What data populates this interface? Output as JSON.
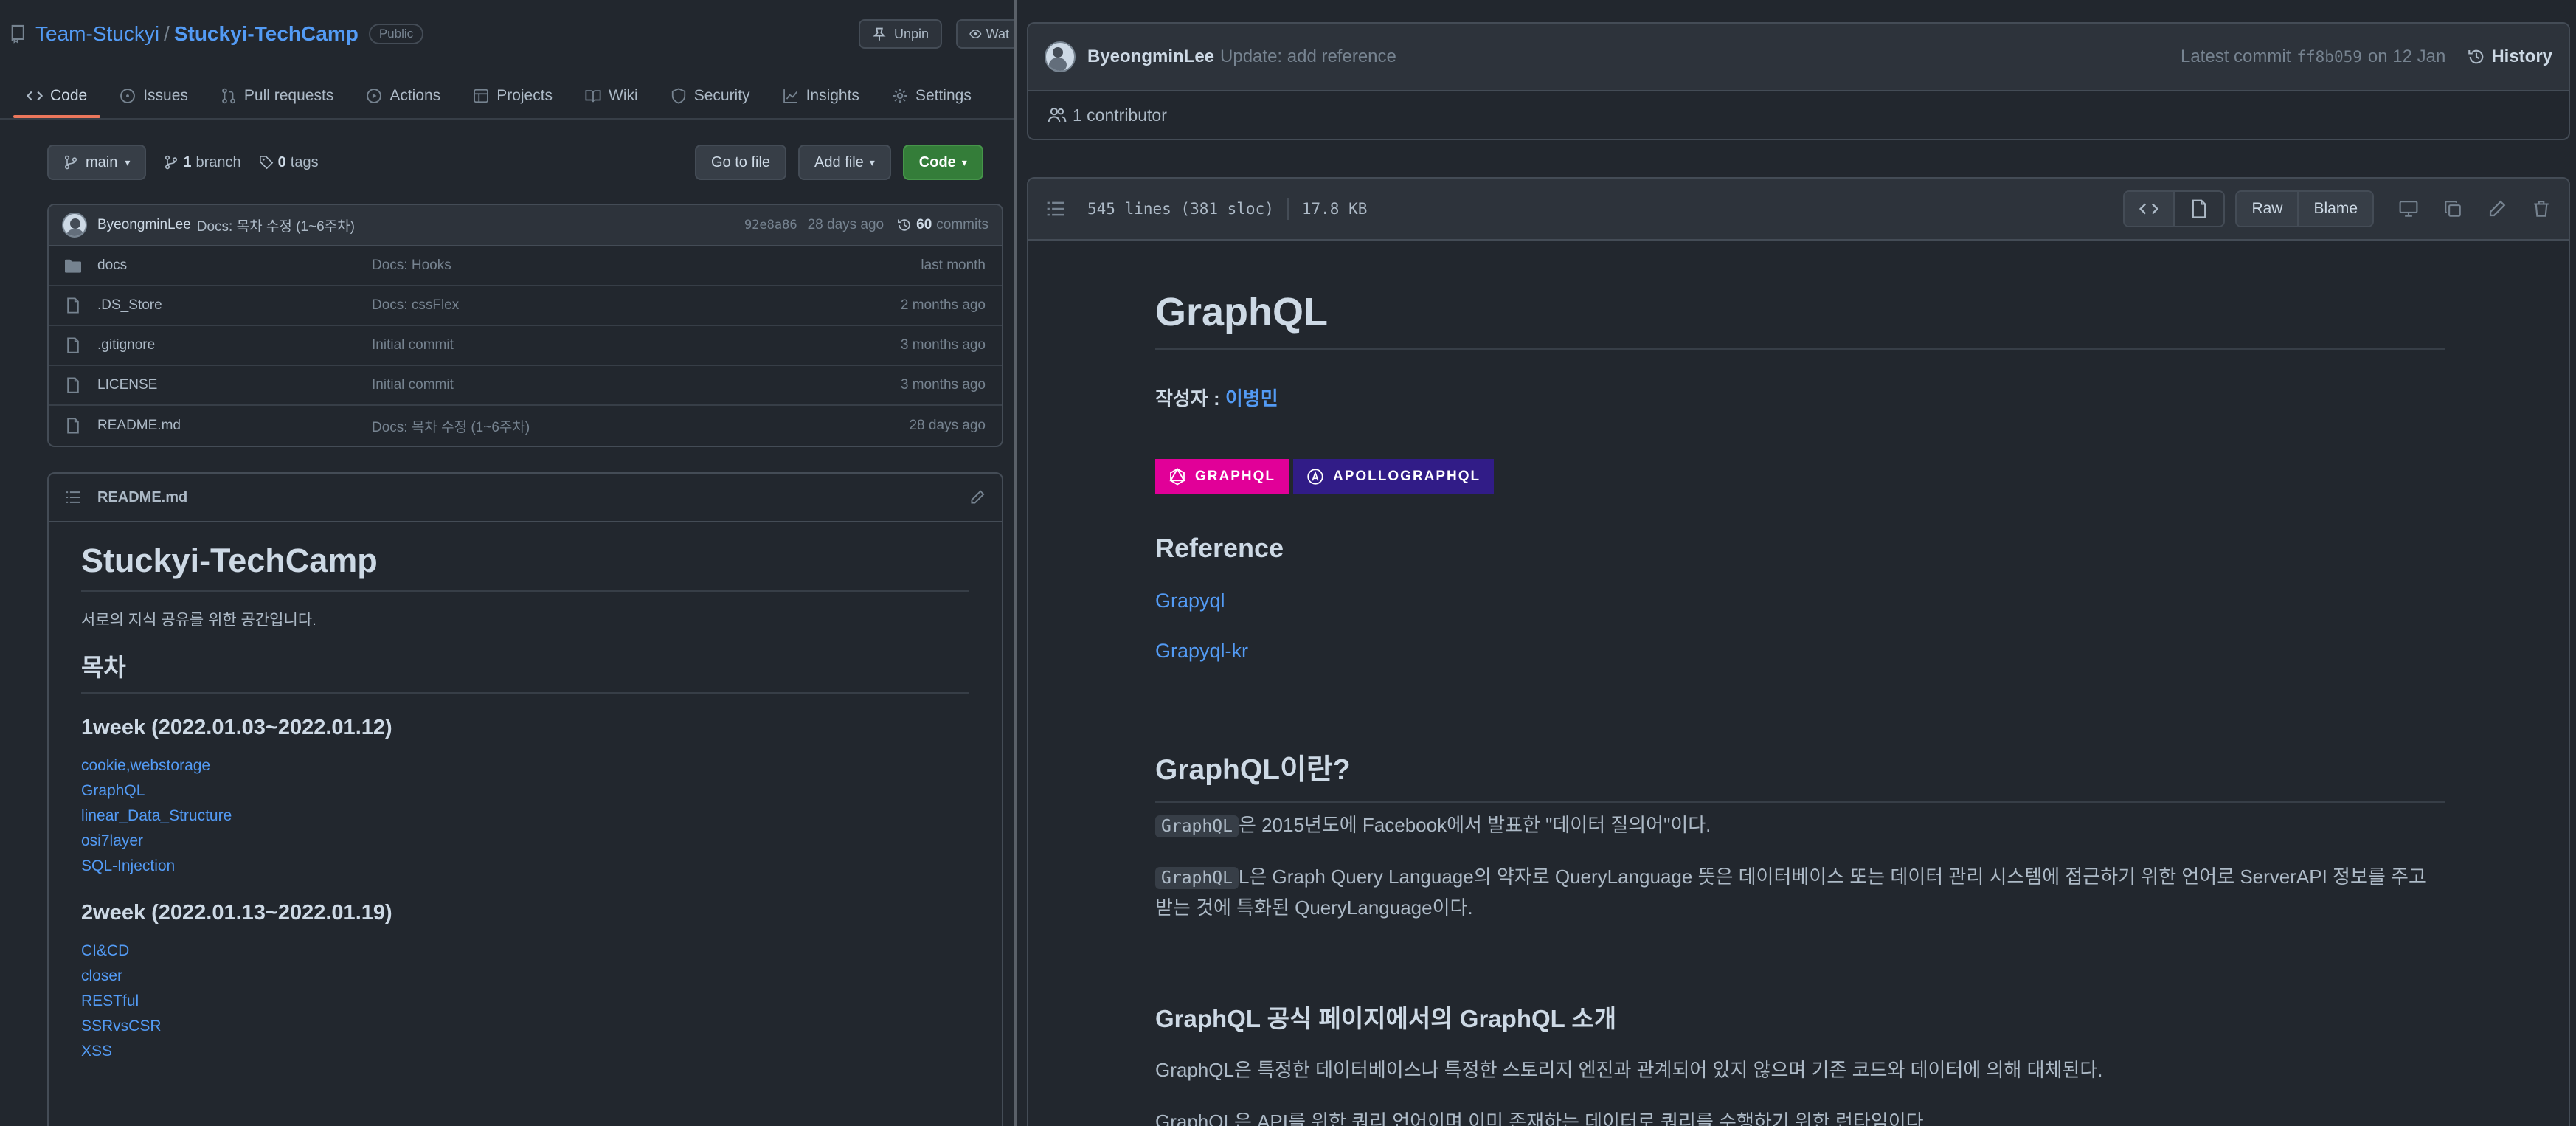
{
  "left": {
    "owner": "Team-Stuckyi",
    "separator": "/",
    "repo": "Stuckyi-TechCamp",
    "visibility": "Public",
    "unpin_label": "Unpin",
    "watch_label": "Wat",
    "tabs": [
      {
        "label": "Code",
        "icon": "code-icon"
      },
      {
        "label": "Issues",
        "icon": "issue-icon"
      },
      {
        "label": "Pull requests",
        "icon": "pull-request-icon"
      },
      {
        "label": "Actions",
        "icon": "play-icon"
      },
      {
        "label": "Projects",
        "icon": "table-icon"
      },
      {
        "label": "Wiki",
        "icon": "book-icon"
      },
      {
        "label": "Security",
        "icon": "shield-icon"
      },
      {
        "label": "Insights",
        "icon": "graph-icon"
      },
      {
        "label": "Settings",
        "icon": "gear-icon"
      }
    ],
    "branch": "main",
    "branch_count": "1",
    "branch_word": "branch",
    "tag_count": "0",
    "tag_word": "tags",
    "go_to_file": "Go to file",
    "add_file": "Add file",
    "code_button": "Code",
    "latest_commit": {
      "author": "ByeongminLee",
      "message": "Docs: 목차 수정 (1~6주차)",
      "hash": "92e8a86",
      "age": "28 days ago",
      "commit_count": "60",
      "commit_word": "commits"
    },
    "files": [
      {
        "name": "docs",
        "type": "folder",
        "message": "Docs: Hooks",
        "age": "last month"
      },
      {
        "name": ".DS_Store",
        "type": "file",
        "message": "Docs: cssFlex",
        "age": "2 months ago"
      },
      {
        "name": ".gitignore",
        "type": "file",
        "message": "Initial commit",
        "age": "3 months ago"
      },
      {
        "name": "LICENSE",
        "type": "file",
        "message": "Initial commit",
        "age": "3 months ago"
      },
      {
        "name": "README.md",
        "type": "file",
        "message": "Docs: 목차 수정 (1~6주차)",
        "age": "28 days ago"
      }
    ],
    "readme": {
      "filename": "README.md",
      "title": "Stuckyi-TechCamp",
      "intro": "서로의 지식 공유를 위한 공간입니다.",
      "toc_heading": "목차",
      "week1_heading": "1week (2022.01.03~2022.01.12)",
      "week1_links": [
        "cookie,webstorage",
        "GraphQL",
        "linear_Data_Structure",
        "osi7layer",
        "SQL-Injection"
      ],
      "week2_heading": "2week (2022.01.13~2022.01.19)",
      "week2_links": [
        "CI&CD",
        "closer",
        "RESTful",
        "SSRvsCSR",
        "XSS"
      ]
    }
  },
  "right": {
    "commit": {
      "author": "ByeongminLee",
      "message": "Update: add reference",
      "latest_label": "Latest commit",
      "hash": "ff8b059",
      "date": "on 12 Jan",
      "history": "History"
    },
    "contributors": "1 contributor",
    "file_info": {
      "lines": "545 lines (381 sloc)",
      "size": "17.8 KB",
      "raw": "Raw",
      "blame": "Blame"
    },
    "doc": {
      "title": "GraphQL",
      "author_label": "작성자 :",
      "author_name": "이병민",
      "badge1": "GRAPHQL",
      "badge2": "APOLLOGRAPHQL",
      "reference_heading": "Reference",
      "ref_links": [
        "Grapyql",
        "Grapyql-kr"
      ],
      "section1_heading": "GraphQL이란?",
      "p1_code": "GraphQL",
      "p1_text": "은 2015년도에 Facebook에서 발표한 \"데이터 질의어\"이다.",
      "p2_code": "GraphQL",
      "p2_text": "L은 Graph Query Language의 약자로 QueryLanguage 뜻은 데이터베이스 또는 데이터 관리 시스템에 접근하기 위한 언어로 ServerAPI 정보를 주고 받는 것에 특화된 QueryLanguage이다.",
      "section2_heading": "GraphQL 공식 페이지에서의 GraphQL 소개",
      "p3": "GraphQL은 특정한 데이터베이스나 특정한 스토리지 엔진과 관계되어 있지 않으며 기존 코드와 데이터에 의해 대체된다.",
      "p4": "GraphQL은 API를 위한 쿼리 언어이며 이미 존재하는 데이터로 쿼리를 수행하기 위한 런타임이다."
    },
    "colors": {
      "badge1_bg": "#e10098",
      "badge2_bg": "#311c87",
      "link": "#539bf5",
      "accent_tab": "#ec775c",
      "code_btn": "#347d39"
    }
  }
}
